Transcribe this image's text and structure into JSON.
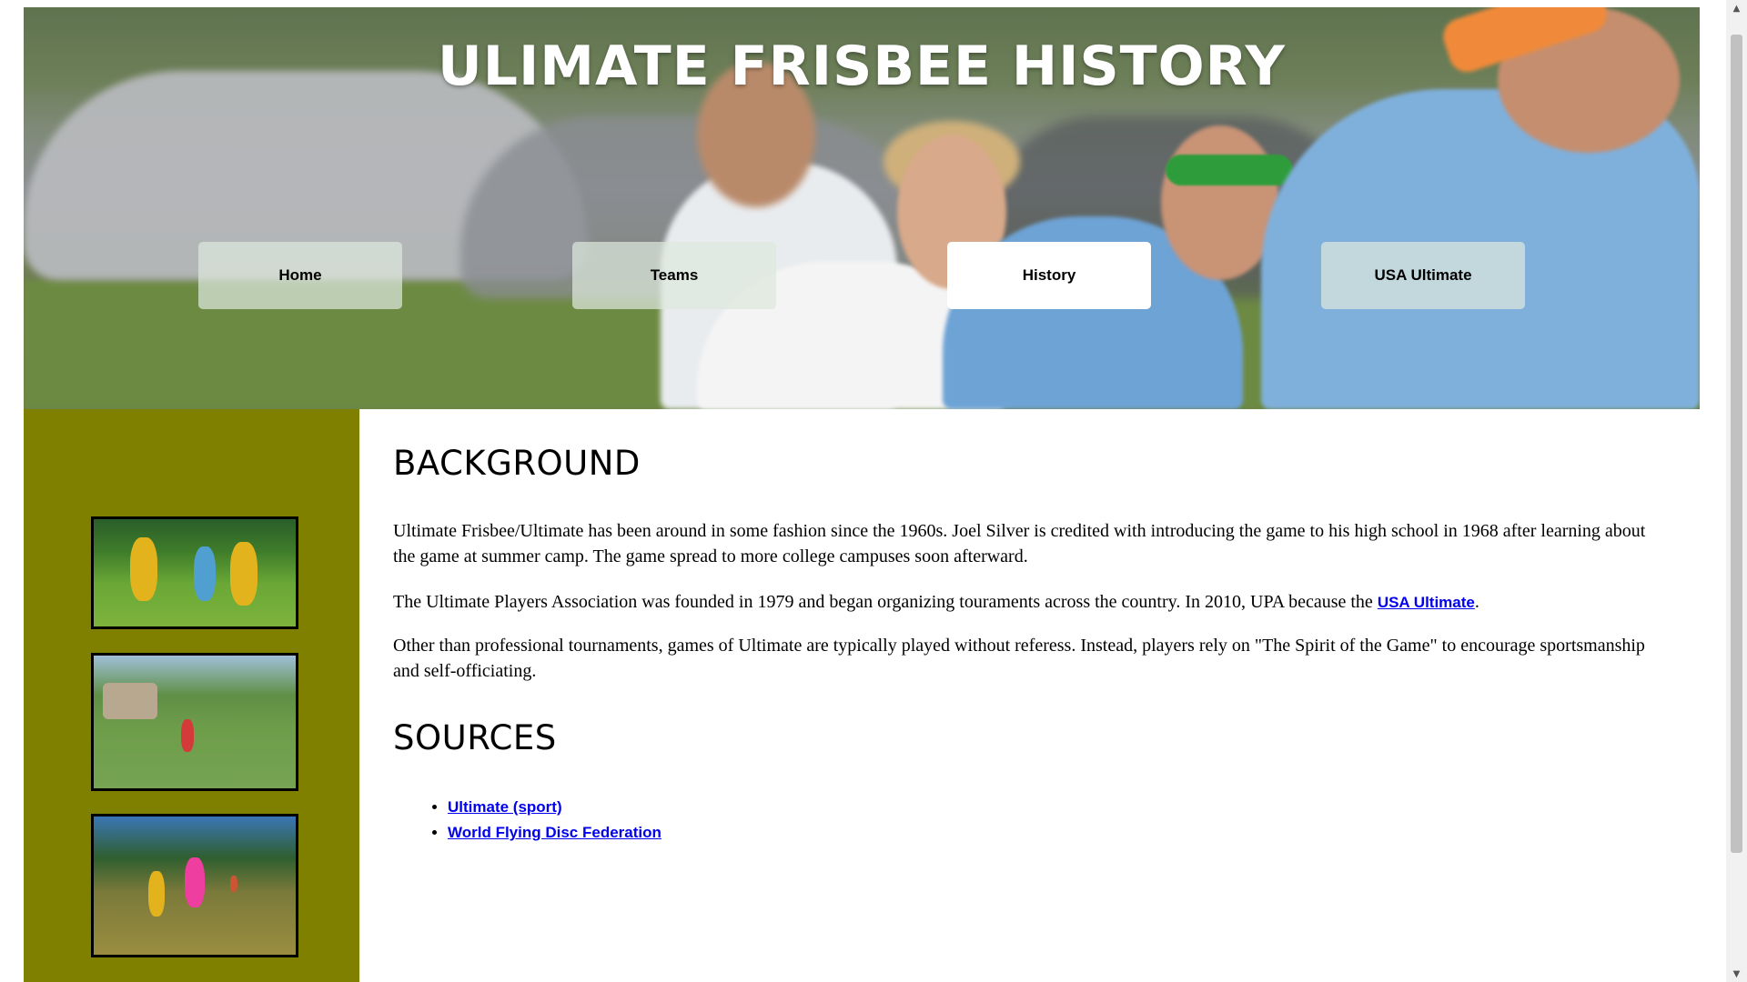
{
  "header": {
    "title": "ULIMATE FRISBEE HISTORY"
  },
  "nav": {
    "items": [
      {
        "label": "Home"
      },
      {
        "label": "Teams"
      },
      {
        "label": "History",
        "active": true
      },
      {
        "label": "USA Ultimate"
      }
    ]
  },
  "main": {
    "background_heading": "BACKGROUND",
    "p1": "Ultimate Frisbee/Ultimate has been around in some fashion since the 1960s. Joel Silver is credited with introducing the game to his high school in 1968 after learning about the game at summer camp. The game spread to more college campuses soon afterward.",
    "p2_before_link": "The Ultimate Players Association was founded in 1979 and began organizing touraments across the country. In 2010, UPA because the ",
    "p2_link": "USA Ultimate",
    "p2_after_link": ".",
    "p3": "Other than professional tournaments, games of Ultimate are typically played without referess. Instead, players rely on \"The Spirit of the Game\" to encourage sportsmanship and self-officiating.",
    "sources_heading": "SOURCES",
    "sources": [
      {
        "label": "Ultimate (sport)"
      },
      {
        "label": "World Flying Disc Federation"
      }
    ]
  },
  "colors": {
    "sidebar": "#808000",
    "link": "#0000ee",
    "nav_active": "#ffffff"
  },
  "icons": {
    "scroll_up": "scroll-up-arrow-icon",
    "scroll_down": "scroll-down-arrow-icon"
  }
}
